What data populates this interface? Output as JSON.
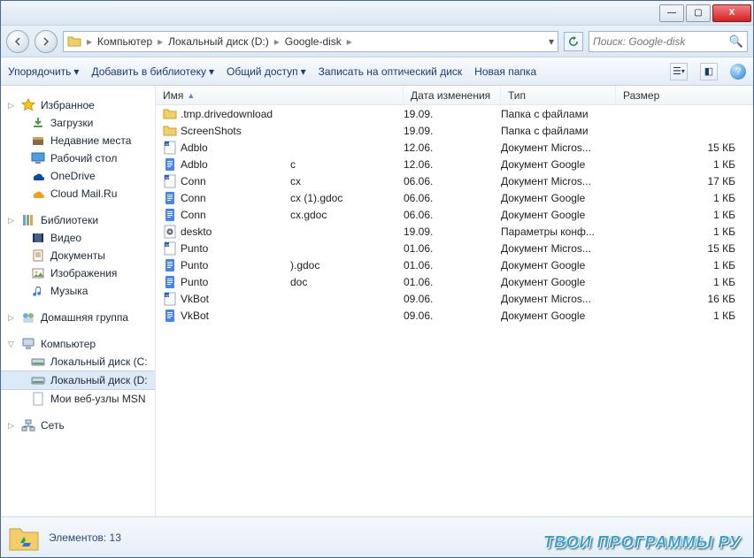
{
  "titlebar": {
    "min": "—",
    "max": "▢",
    "close": "X"
  },
  "breadcrumb": {
    "seg1": "Компьютер",
    "seg2": "Локальный диск (D:)",
    "seg3": "Google-disk"
  },
  "search": {
    "placeholder": "Поиск: Google-disk"
  },
  "toolbar": {
    "organize": "Упорядочить",
    "addlib": "Добавить в библиотеку",
    "share": "Общий доступ",
    "burn": "Записать на оптический диск",
    "newfolder": "Новая папка"
  },
  "sidebar": {
    "fav": "Избранное",
    "fav_items": [
      {
        "label": "Загрузки"
      },
      {
        "label": "Недавние места"
      },
      {
        "label": "Рабочий стол"
      },
      {
        "label": "OneDrive"
      },
      {
        "label": "Cloud Mail.Ru"
      }
    ],
    "lib": "Библиотеки",
    "lib_items": [
      {
        "label": "Видео"
      },
      {
        "label": "Документы"
      },
      {
        "label": "Изображения"
      },
      {
        "label": "Музыка"
      }
    ],
    "homegroup": "Домашняя группа",
    "computer": "Компьютер",
    "comp_items": [
      {
        "label": "Локальный диск (C:"
      },
      {
        "label": "Локальный диск (D:"
      },
      {
        "label": "Мои веб-узлы MSN"
      }
    ],
    "network": "Сеть"
  },
  "columns": {
    "name": "Имя",
    "date": "Дата изменения",
    "type": "Тип",
    "size": "Размер"
  },
  "files": [
    {
      "icon": "folder",
      "name": ".tmp.drivedownload",
      "ext": "",
      "date": "19.09.",
      "type": "Папка с файлами",
      "size": ""
    },
    {
      "icon": "folder",
      "name": "ScreenShots",
      "ext": "",
      "date": "19.09.",
      "type": "Папка с файлами",
      "size": ""
    },
    {
      "icon": "msword",
      "name": "Adblo",
      "ext": "",
      "date": "12.06.",
      "type": "Документ Micros...",
      "size": "15 КБ"
    },
    {
      "icon": "gdoc",
      "name": "Adblo",
      "ext": "c",
      "date": "12.06.",
      "type": "Документ Google",
      "size": "1 КБ"
    },
    {
      "icon": "msword",
      "name": "Conn",
      "ext": "cx",
      "date": "06.06.",
      "type": "Документ Micros...",
      "size": "17 КБ"
    },
    {
      "icon": "gdoc",
      "name": "Conn",
      "ext": "cx (1).gdoc",
      "date": "06.06.",
      "type": "Документ Google",
      "size": "1 КБ"
    },
    {
      "icon": "gdoc",
      "name": "Conn",
      "ext": "cx.gdoc",
      "date": "06.06.",
      "type": "Документ Google",
      "size": "1 КБ"
    },
    {
      "icon": "ini",
      "name": "deskto",
      "ext": "",
      "date": "19.09.",
      "type": "Параметры конф...",
      "size": "1 КБ"
    },
    {
      "icon": "msword",
      "name": "Punto",
      "ext": "",
      "date": "01.06.",
      "type": "Документ Micros...",
      "size": "15 КБ"
    },
    {
      "icon": "gdoc",
      "name": "Punto",
      "ext": ").gdoc",
      "date": "01.06.",
      "type": "Документ Google",
      "size": "1 КБ"
    },
    {
      "icon": "gdoc",
      "name": "Punto",
      "ext": "doc",
      "date": "01.06.",
      "type": "Документ Google",
      "size": "1 КБ"
    },
    {
      "icon": "msword",
      "name": "VkBot",
      "ext": "",
      "date": "09.06.",
      "type": "Документ Micros...",
      "size": "16 КБ"
    },
    {
      "icon": "gdoc",
      "name": "VkBot",
      "ext": "",
      "date": "09.06.",
      "type": "Документ Google",
      "size": "1 КБ"
    }
  ],
  "status": {
    "label": "Элементов: 13"
  },
  "watermark": "ТВОИ ПРОГРАММЫ РУ"
}
